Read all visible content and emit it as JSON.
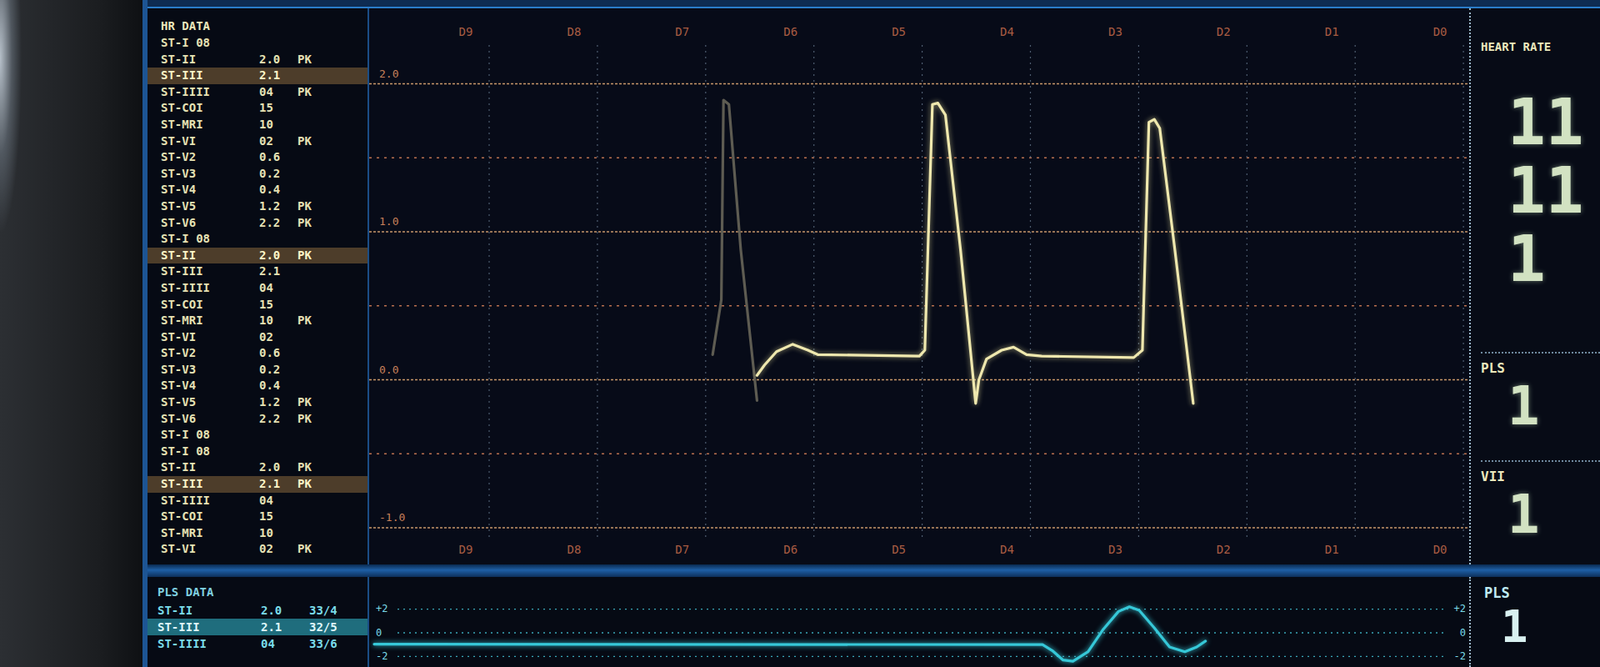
{
  "hr_data": {
    "title": "HR DATA",
    "rows": [
      {
        "label": "ST-I 08",
        "selected": false
      },
      {
        "label": "ST-II",
        "value": "2.0",
        "flag": "PK",
        "selected": false
      },
      {
        "label": "ST-III",
        "value": "2.1",
        "selected": true
      },
      {
        "label": "ST-IIII",
        "value": "04",
        "flag": "PK",
        "selected": false
      },
      {
        "label": "ST-COI",
        "value": "15",
        "selected": false
      },
      {
        "label": "ST-MRI",
        "value": "10",
        "selected": false
      },
      {
        "label": "ST-VI",
        "value": "02",
        "flag": "PK",
        "selected": false
      },
      {
        "label": "ST-V2",
        "value": "0.6",
        "selected": false
      },
      {
        "label": "ST-V3",
        "value": "0.2",
        "selected": false
      },
      {
        "label": "ST-V4",
        "value": "0.4",
        "selected": false
      },
      {
        "label": "ST-V5",
        "value": "1.2",
        "flag": "PK",
        "selected": false
      },
      {
        "label": "ST-V6",
        "value": "2.2",
        "flag": "PK",
        "selected": false
      },
      {
        "label": "ST-I 08",
        "selected": false
      },
      {
        "label": "ST-II",
        "value": "2.0",
        "flag": "PK",
        "selected": true
      },
      {
        "label": "ST-III",
        "value": "2.1",
        "selected": false
      },
      {
        "label": "ST-IIII",
        "value": "04",
        "selected": false
      },
      {
        "label": "ST-COI",
        "value": "15",
        "selected": false
      },
      {
        "label": "ST-MRI",
        "value": "10",
        "flag": "PK",
        "selected": false
      },
      {
        "label": "ST-VI",
        "value": "02",
        "selected": false
      },
      {
        "label": "ST-V2",
        "value": "0.6",
        "selected": false
      },
      {
        "label": "ST-V3",
        "value": "0.2",
        "selected": false
      },
      {
        "label": "ST-V4",
        "value": "0.4",
        "selected": false
      },
      {
        "label": "ST-V5",
        "value": "1.2",
        "flag": "PK",
        "selected": false
      },
      {
        "label": "ST-V6",
        "value": "2.2",
        "flag": "PK",
        "selected": false
      },
      {
        "label": "ST-I 08",
        "selected": false
      },
      {
        "label": "ST-I 08",
        "selected": false
      },
      {
        "label": "ST-II",
        "value": "2.0",
        "flag": "PK",
        "selected": false
      },
      {
        "label": "ST-III",
        "value": "2.1",
        "flag": "PK",
        "selected": true
      },
      {
        "label": "ST-IIII",
        "value": "04",
        "selected": false
      },
      {
        "label": "ST-COI",
        "value": "15",
        "selected": false
      },
      {
        "label": "ST-MRI",
        "value": "10",
        "selected": false
      },
      {
        "label": "ST-VI",
        "value": "02",
        "flag": "PK",
        "selected": false
      }
    ]
  },
  "ecg": {
    "top_ticks": [
      "D9",
      "D8",
      "D7",
      "D6",
      "D5",
      "D4",
      "D3",
      "D2",
      "D1",
      "D0"
    ],
    "bottom_ticks": [
      "D9",
      "D8",
      "D7",
      "D6",
      "D5",
      "D4",
      "D3",
      "D2",
      "D1",
      "D0"
    ],
    "y_ticks": [
      "2.0",
      "1.0",
      "0.0",
      "-1.0"
    ],
    "series": [
      {
        "name": "previous",
        "color": "#5e5c52",
        "d": [
          6.72,
          6.64,
          6.62,
          6.57,
          6.46,
          6.31
        ],
        "v": [
          0.17,
          0.54,
          1.89,
          1.86,
          0.88,
          -0.14
        ]
      },
      {
        "name": "current",
        "color": "#efe8ae",
        "d": [
          6.31,
          6.24,
          6.13,
          5.98,
          5.84,
          5.75,
          4.81,
          4.76,
          4.69,
          4.64,
          4.57,
          4.43,
          4.29,
          4.26,
          4.19,
          4.05,
          3.94,
          3.82,
          3.68,
          2.83,
          2.75,
          2.69,
          2.64,
          2.59,
          2.45,
          2.28
        ],
        "v": [
          0.03,
          0.1,
          0.19,
          0.24,
          0.2,
          0.17,
          0.16,
          0.2,
          1.86,
          1.87,
          1.79,
          0.88,
          -0.16,
          0.0,
          0.14,
          0.2,
          0.22,
          0.17,
          0.16,
          0.15,
          0.2,
          1.74,
          1.76,
          1.7,
          0.88,
          -0.16
        ]
      }
    ]
  },
  "heart_rate": {
    "title": "HEART RATE",
    "values": [
      "11",
      "11",
      "1"
    ],
    "sections": [
      {
        "label": "PLS",
        "value": "1"
      },
      {
        "label": "VII",
        "value": "1"
      }
    ]
  },
  "pls_data": {
    "title": "PLS DATA",
    "rows": [
      {
        "label": "ST-II",
        "value": "2.0",
        "ratio": "33/4",
        "selected": false
      },
      {
        "label": "ST-III",
        "value": "2.1",
        "ratio": "32/5",
        "selected": true
      },
      {
        "label": "ST-IIII",
        "value": "04",
        "ratio": "33/6",
        "selected": false
      }
    ],
    "scale": [
      "+2",
      "0",
      "-2"
    ],
    "right_scale": [
      "+2",
      "0",
      "-2"
    ],
    "wave": {
      "color": "#36c8d8",
      "t": [
        0,
        0.615,
        0.624,
        0.634,
        0.643,
        0.657,
        0.671,
        0.685,
        0.695,
        0.704,
        0.718,
        0.732,
        0.746,
        0.757,
        0.765
      ],
      "v": [
        -0.96,
        -1.0,
        -1.5,
        -2.3,
        -2.4,
        -1.6,
        0.3,
        1.8,
        2.2,
        1.9,
        0.4,
        -1.2,
        -1.6,
        -1.2,
        -0.7
      ]
    },
    "label": "PLS",
    "value": "1"
  }
}
